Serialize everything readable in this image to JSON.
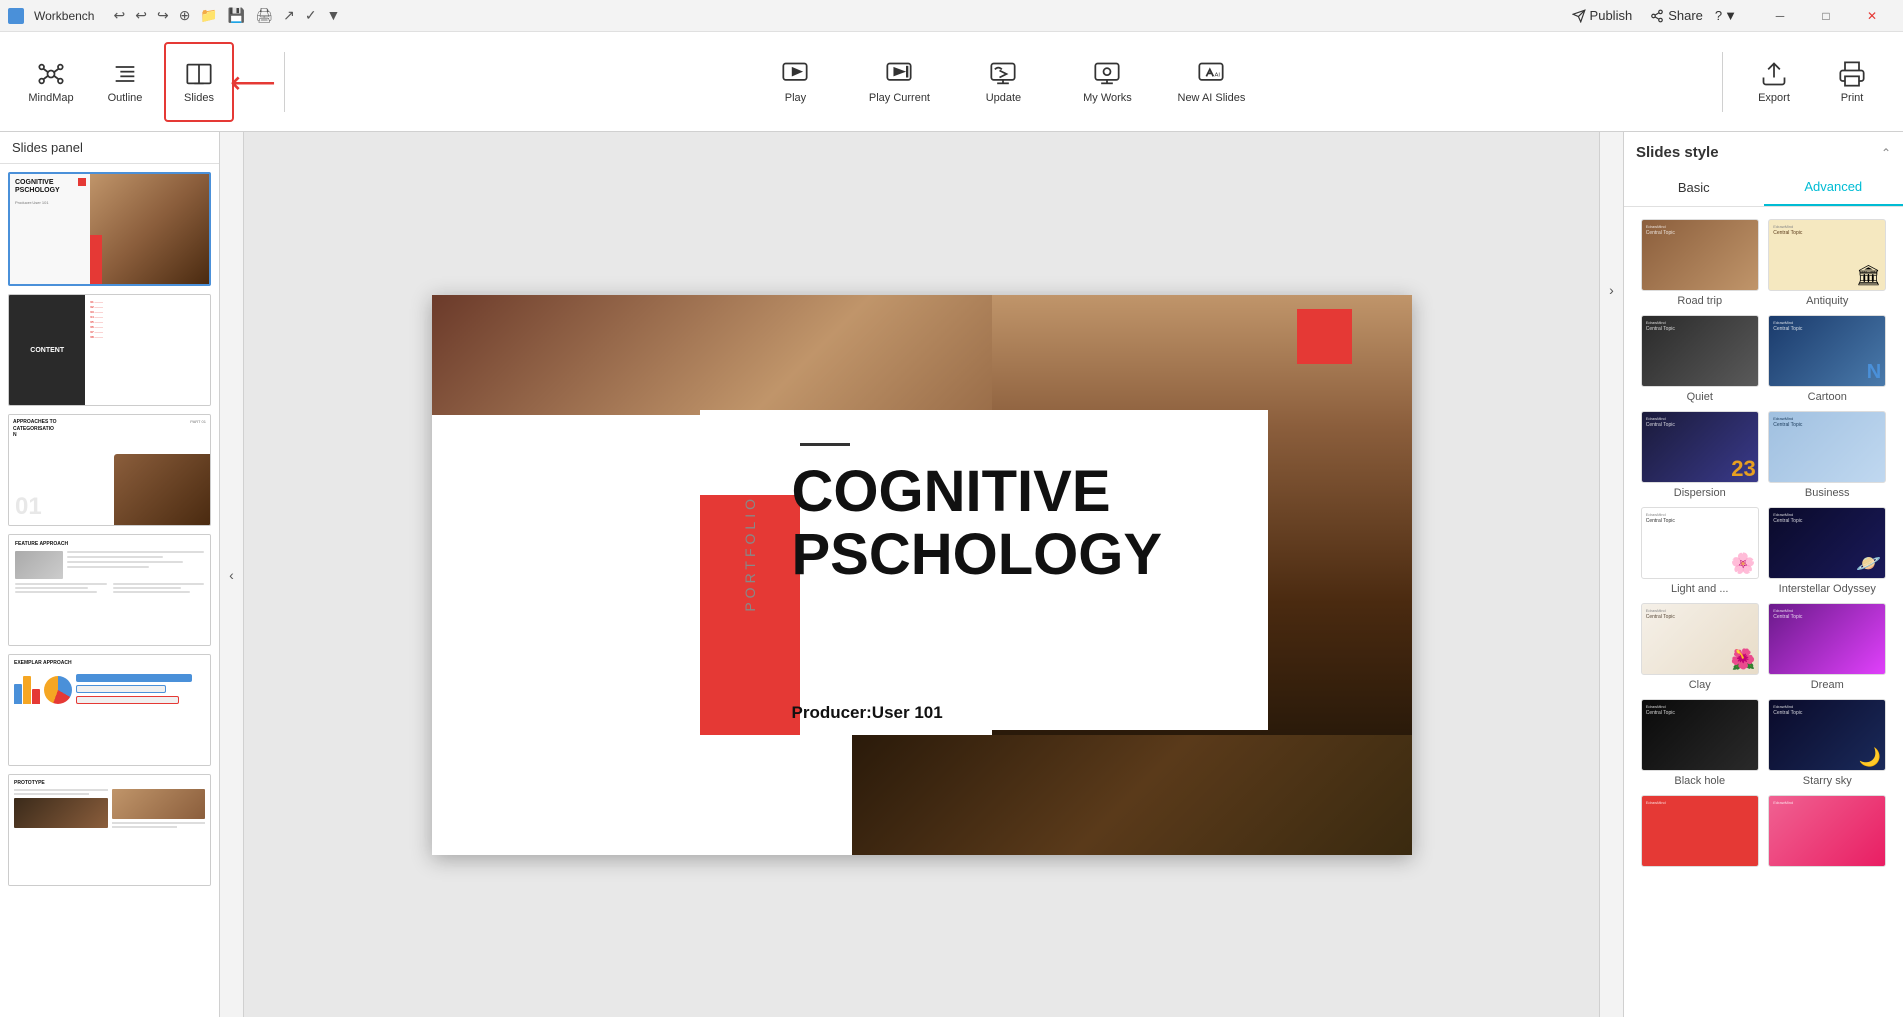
{
  "titlebar": {
    "app_title": "Workbench",
    "publish_label": "Publish",
    "share_label": "Share",
    "help_label": "?"
  },
  "toolbar": {
    "mindmap_label": "MindMap",
    "outline_label": "Outline",
    "slides_label": "Slides",
    "play_label": "Play",
    "play_current_label": "Play Current",
    "update_label": "Update",
    "my_works_label": "My Works",
    "new_ai_slides_label": "New AI Slides",
    "export_label": "Export",
    "print_label": "Print"
  },
  "slides_panel": {
    "header": "Slides panel",
    "slides": [
      {
        "id": 1,
        "title": "COGNITIVE PSCHOLOGY",
        "subtitle": "Producer:User 101"
      },
      {
        "id": 2,
        "title": "CONTENT 1"
      },
      {
        "id": 3,
        "title": "APPROACHES TO CATEGORISATION N",
        "part": "PART 01"
      },
      {
        "id": 4,
        "title": "FEATURE APPROACH"
      },
      {
        "id": 5,
        "title": "EXEMPLAR APPROACH"
      },
      {
        "id": 6,
        "title": "PROTOTYPE"
      }
    ]
  },
  "canvas": {
    "title_line1": "COGNITIVE",
    "title_line2": "PSCHOLOGY",
    "subtitle": "Producer:User 101",
    "portfolio_text": "PORTFOLIO"
  },
  "right_panel": {
    "title": "Slides style",
    "tab_basic": "Basic",
    "tab_advanced": "Advanced",
    "styles": [
      {
        "id": "road-trip",
        "label": "Road trip"
      },
      {
        "id": "antiquity",
        "label": "Antiquity"
      },
      {
        "id": "quiet",
        "label": "Quiet"
      },
      {
        "id": "cartoon",
        "label": "Cartoon"
      },
      {
        "id": "dispersion",
        "label": "Dispersion"
      },
      {
        "id": "business",
        "label": "Business"
      },
      {
        "id": "light",
        "label": "Light and ..."
      },
      {
        "id": "interstellar",
        "label": "Interstellar Odyssey"
      },
      {
        "id": "clay",
        "label": "Clay"
      },
      {
        "id": "dream",
        "label": "Dream"
      },
      {
        "id": "blackhole",
        "label": "Black hole"
      },
      {
        "id": "starry",
        "label": "Starry sky"
      }
    ]
  }
}
